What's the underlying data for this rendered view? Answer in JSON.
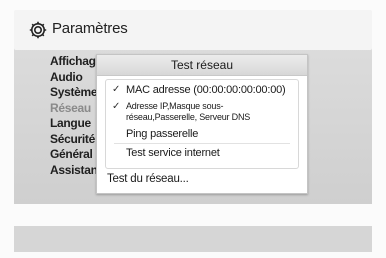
{
  "header": {
    "title": "Paramètres",
    "icon": "gear-icon"
  },
  "sidebar": {
    "items": [
      {
        "label": "Affichage"
      },
      {
        "label": "Audio"
      },
      {
        "label": "Système"
      },
      {
        "label": "Réseau"
      },
      {
        "label": "Langue"
      },
      {
        "label": "Sécurité"
      },
      {
        "label": "Général"
      },
      {
        "label": "Assistance"
      }
    ]
  },
  "dialog": {
    "title": "Test réseau",
    "options": [
      {
        "check": "✓",
        "label": "MAC adresse (00:00:00:00:00:00)"
      },
      {
        "check": "✓",
        "label": "Adresse IP,Masque sous-réseau,Passerelle, Serveur DNS"
      },
      {
        "check": "",
        "label": "Ping passerelle"
      },
      {
        "check": "",
        "label": "Test service internet"
      }
    ],
    "button_label": "Test du réseau..."
  },
  "colors": {
    "panel": "#d4d4d4",
    "dialog_title_bg": "#dedede",
    "text": "#1f1f1f",
    "disabled_text": "#8a8a8a"
  }
}
